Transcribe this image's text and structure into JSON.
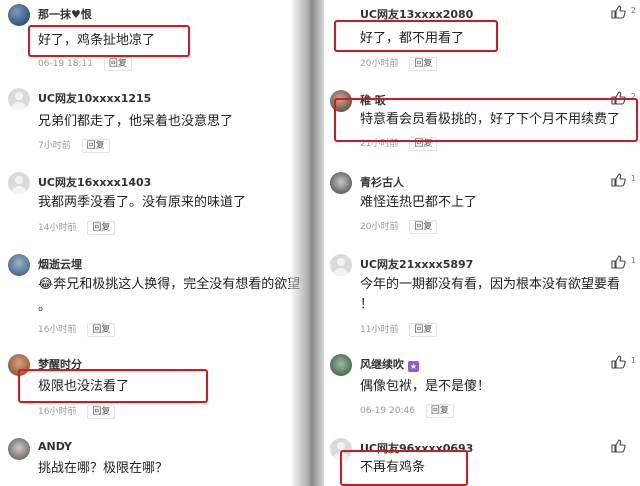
{
  "left": {
    "comments": [
      {
        "user": "那一抹♥恨",
        "text": "好了，鸡条扯地凉了",
        "meta": "06-19 18:11",
        "reply": "回复"
      },
      {
        "user": "UC网友10xxxx1215",
        "text": "兄弟们都走了，他呆着也没意思了",
        "meta": "7小时前",
        "reply": "回复"
      },
      {
        "user": "UC网友16xxxx1403",
        "text": "我都两季没看了。没有原来的味道了",
        "meta": "14小时前",
        "reply": "回复"
      },
      {
        "user": "烟逝云埋",
        "text": "😂奔兄和极挑这人换得，完全没有想看的欲望",
        "text2": "。",
        "meta": "16小时前",
        "reply": "回复"
      },
      {
        "user": "梦醒时分",
        "text": "极限也没法看了",
        "meta": "16小时前",
        "reply": "回复"
      },
      {
        "user": "ANDY",
        "text": "挑战在哪？极限在哪？",
        "meta": "",
        "reply": ""
      }
    ]
  },
  "right": {
    "comments": [
      {
        "user": "UC网友13xxxx2080",
        "text": "好了，都不用看了",
        "meta": "20小时前",
        "reply": "回复",
        "likes": "2"
      },
      {
        "user": "稚 昄",
        "text": "特意看会员看极挑的，好了下个月不用续费了",
        "meta": "21小时前",
        "reply": "回复",
        "likes": "2"
      },
      {
        "user": "青衫古人",
        "text": "难怪连热巴都不上了",
        "meta": "20小时前",
        "reply": "回复",
        "likes": "1"
      },
      {
        "user": "UC网友21xxxx5897",
        "text": "今年的一期都没有看，因为根本没有欲望要看",
        "text2": "！",
        "meta": "11小时前",
        "reply": "回复",
        "likes": "1"
      },
      {
        "user": "风继续吹",
        "text": "偶像包袱，是不是傻！",
        "meta": "06-19 20:46",
        "reply": "回复",
        "likes": "1"
      },
      {
        "user": "UC网友96xxxx0693",
        "text": "不再有鸡条",
        "meta": "",
        "reply": "",
        "likes": ""
      }
    ]
  },
  "colors": {
    "highlight": "#d6181e",
    "text": "#222222",
    "meta": "#9a9a9a",
    "badge": "#8e5ad6"
  },
  "icons": {
    "like": "thumbs-up-icon",
    "avatar_default": "default-avatar-icon"
  }
}
